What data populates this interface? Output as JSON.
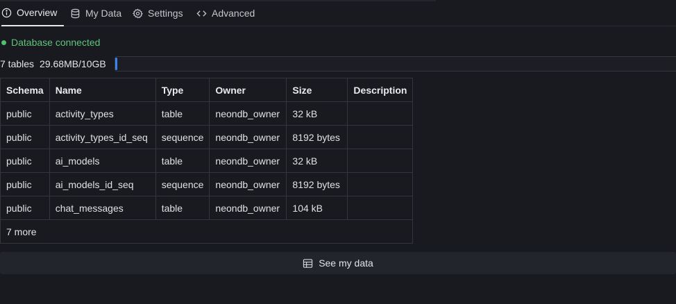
{
  "tabs": [
    {
      "label": "Overview",
      "icon": "info-circle-icon"
    },
    {
      "label": "My Data",
      "icon": "database-icon"
    },
    {
      "label": "Settings",
      "icon": "gear-icon"
    },
    {
      "label": "Advanced",
      "icon": "code-icon"
    }
  ],
  "status": {
    "text": "Database connected",
    "color": "#4cc46c"
  },
  "storage": {
    "tables_count": "7 tables",
    "usage": "29.68MB/10GB",
    "used_fraction": 0.003,
    "accent": "#3b82f6"
  },
  "table": {
    "headers": [
      "Schema",
      "Name",
      "Type",
      "Owner",
      "Size",
      "Description"
    ],
    "rows": [
      [
        "public",
        "activity_types",
        "table",
        "neondb_owner",
        "32 kB",
        ""
      ],
      [
        "public",
        "activity_types_id_seq",
        "sequence",
        "neondb_owner",
        "8192 bytes",
        ""
      ],
      [
        "public",
        "ai_models",
        "table",
        "neondb_owner",
        "32 kB",
        ""
      ],
      [
        "public",
        "ai_models_id_seq",
        "sequence",
        "neondb_owner",
        "8192 bytes",
        ""
      ],
      [
        "public",
        "chat_messages",
        "table",
        "neondb_owner",
        "104 kB",
        ""
      ]
    ],
    "more_label": "7 more"
  },
  "see_data_button": {
    "label": "See my data",
    "icon": "table-icon"
  }
}
